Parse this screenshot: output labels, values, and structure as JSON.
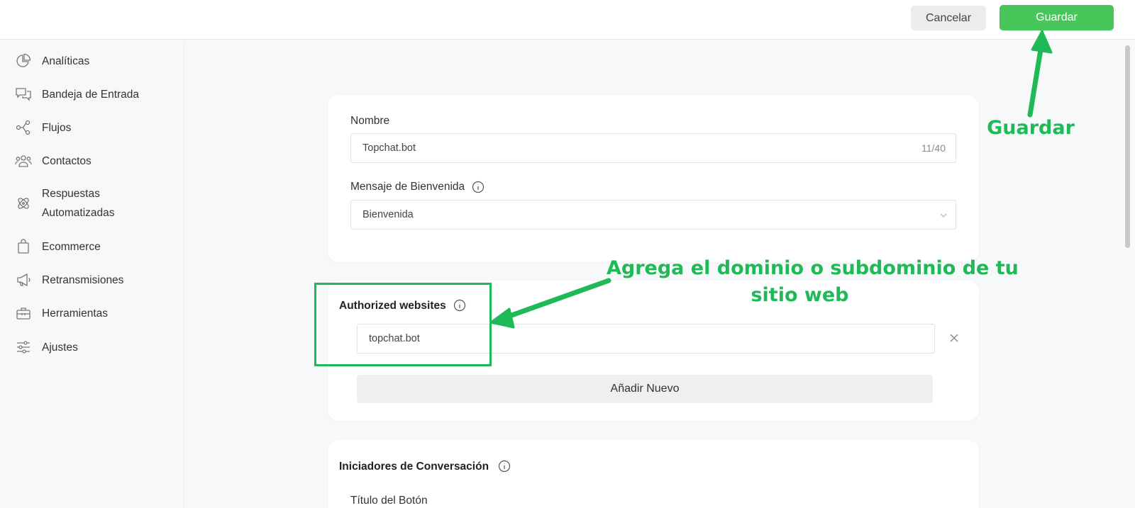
{
  "toolbar": {
    "cancel_label": "Cancelar",
    "save_label": "Guardar"
  },
  "sidebar": {
    "items": [
      {
        "label": "Analíticas",
        "icon": "pie-chart-icon"
      },
      {
        "label": "Bandeja de Entrada",
        "icon": "chat-bubbles-icon"
      },
      {
        "label": "Flujos",
        "icon": "flow-nodes-icon"
      },
      {
        "label": "Contactos",
        "icon": "contacts-group-icon"
      },
      {
        "label": "Respuestas",
        "label2": "Automatizadas",
        "icon": "atom-icon"
      },
      {
        "label": "Ecommerce",
        "icon": "shopping-bag-icon"
      },
      {
        "label": "Retransmisiones",
        "icon": "megaphone-icon"
      },
      {
        "label": "Herramientas",
        "icon": "toolbox-icon"
      },
      {
        "label": "Ajustes",
        "icon": "sliders-icon"
      }
    ]
  },
  "form": {
    "name_label": "Nombre",
    "name_value": "Topchat.bot",
    "name_counter": "11/40",
    "welcome_label": "Mensaje de Bienvenida",
    "welcome_value": "Bienvenida",
    "authorized_title": "Authorized websites",
    "website_value": "topchat.bot",
    "add_new_label": "Añadir Nuevo",
    "starters_title": "Iniciadores de Conversación",
    "button_title_label": "Título del Botón"
  },
  "annotations": {
    "save_note": "Guardar",
    "domain_note_line1": "Agrega el dominio o subdominio de tu",
    "domain_note_line2": "sitio web",
    "color": "#1fba57"
  },
  "colors": {
    "save_button": "#47c75a",
    "annotation": "#1fba57"
  }
}
